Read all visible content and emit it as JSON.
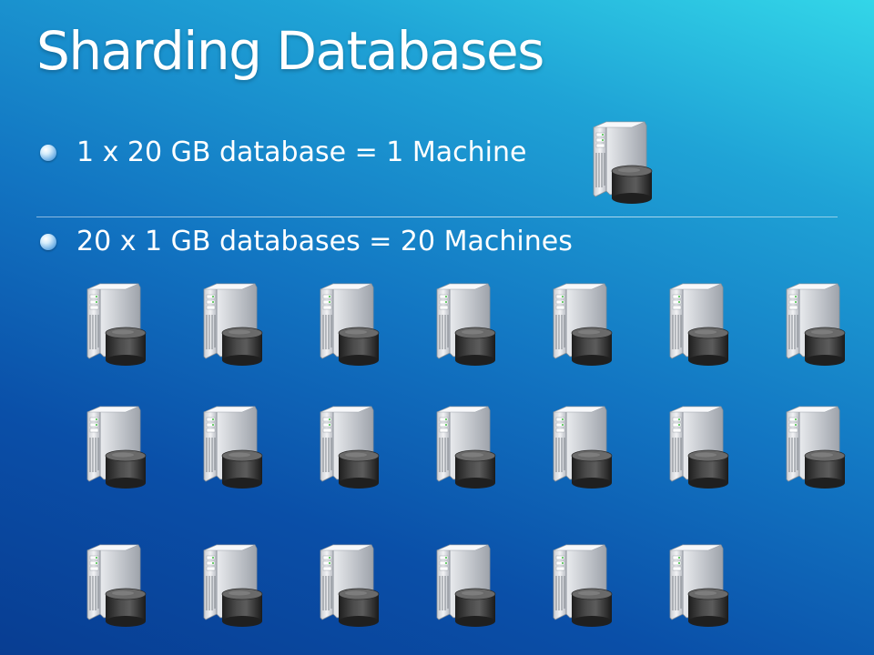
{
  "slide": {
    "title": "Sharding Databases",
    "bullets": [
      "1 x 20 GB database = 1 Machine",
      "20 x 1 GB databases = 20 Machines"
    ]
  },
  "icons": {
    "bullet": "sphere-bullet-icon",
    "machine": "database-server-icon"
  },
  "colors": {
    "background_top_right": "#33d6e8",
    "background_bottom_left": "#083d92",
    "text": "#ffffff"
  }
}
